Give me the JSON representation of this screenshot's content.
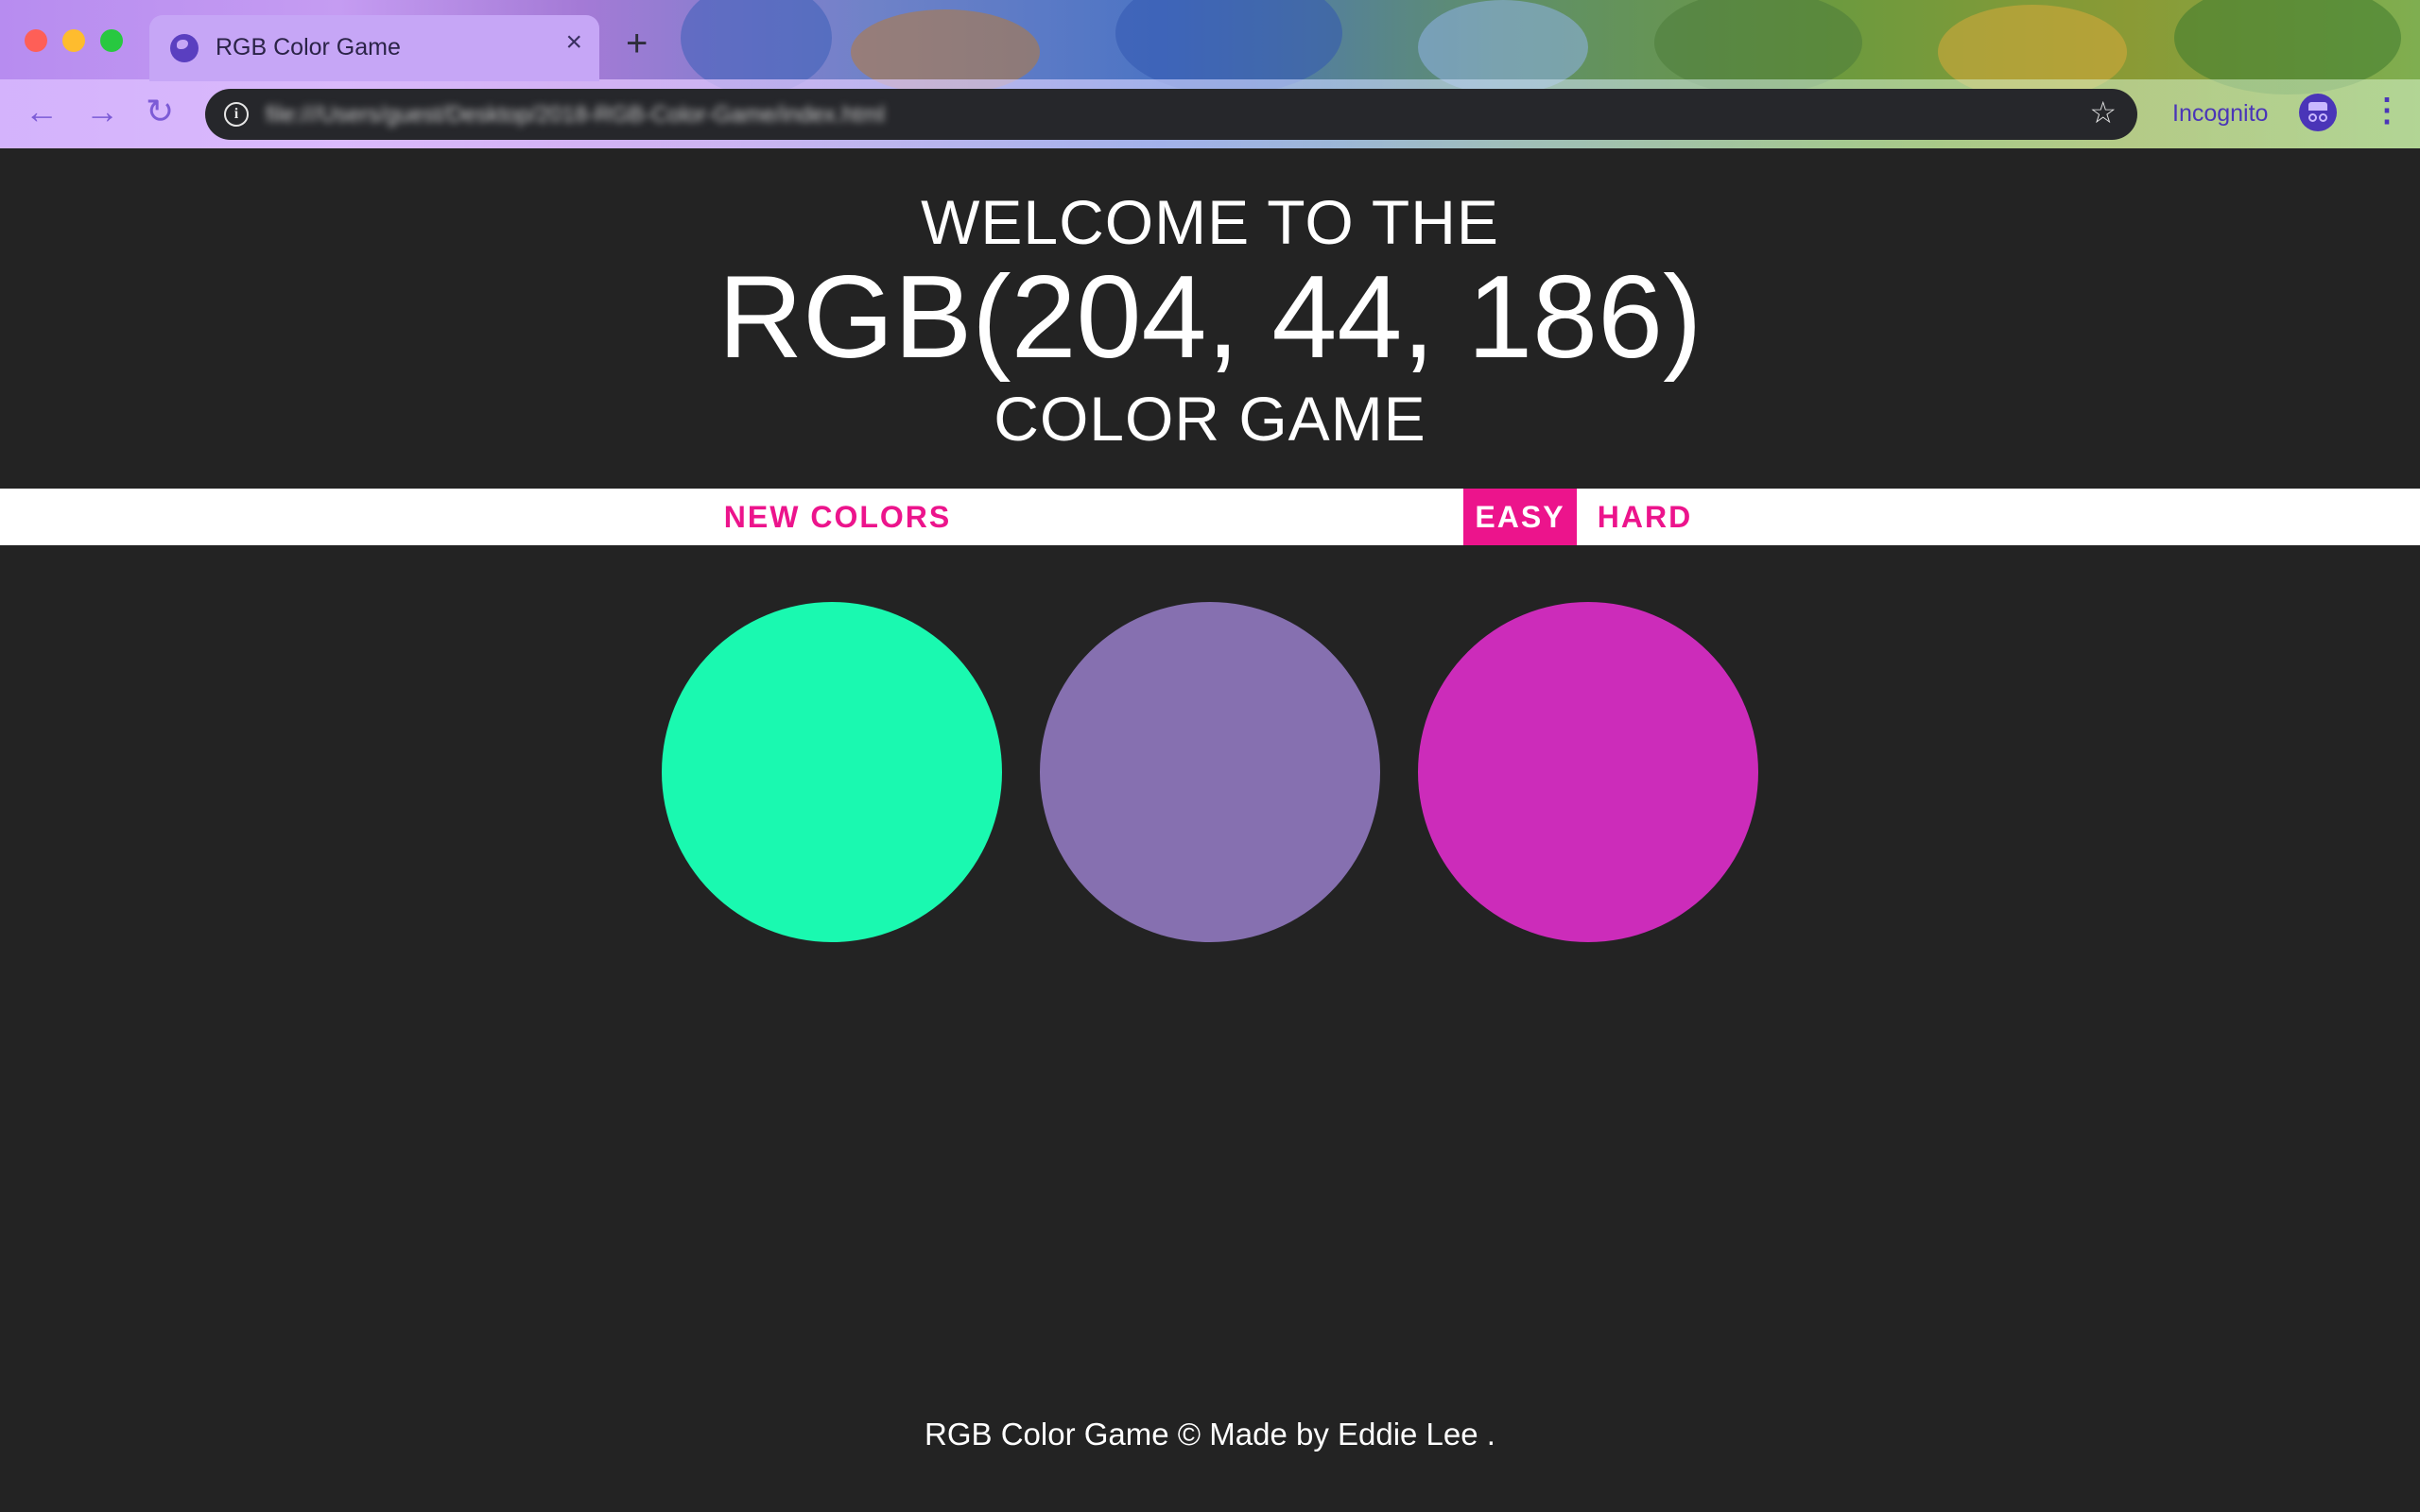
{
  "browser": {
    "tab_title": "RGB Color Game",
    "tab_close": "×",
    "new_tab": "+",
    "back": "←",
    "forward": "→",
    "reload": "↻",
    "url": "file:///Users/guest/Desktop/2018-RGB-Color-Game/index.html",
    "bookmark": "☆",
    "incognito_label": "Incognito",
    "menu": "⋮",
    "traffic_colors": [
      "#fe5f57",
      "#febc2e",
      "#28c840"
    ]
  },
  "game": {
    "header": {
      "welcome": "WELCOME TO THE",
      "target_color": "RGB(204, 44, 186)",
      "subtitle": "COLOR GAME"
    },
    "stripe": {
      "new_colors": "NEW COLORS",
      "message": "",
      "easy": "EASY",
      "hard": "HARD",
      "selected_mode": "EASY",
      "accent_color": "#ec148c"
    },
    "squares": [
      {
        "color": "#1af9b0"
      },
      {
        "color": "#8670b0"
      },
      {
        "color": "#cc2cba"
      }
    ],
    "footer": "RGB Color Game © Made by Eddie Lee ."
  }
}
